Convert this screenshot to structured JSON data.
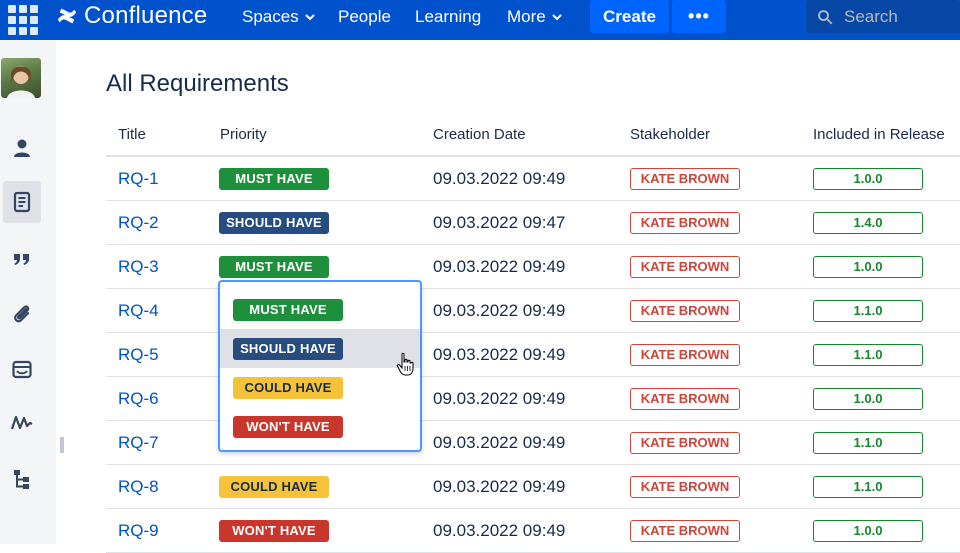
{
  "topnav": {
    "logo_text": "Confluence",
    "items": [
      {
        "label": "Spaces",
        "has_dropdown": true
      },
      {
        "label": "People",
        "has_dropdown": false
      },
      {
        "label": "Learning",
        "has_dropdown": false
      },
      {
        "label": "More",
        "has_dropdown": true
      }
    ],
    "create_label": "Create",
    "more_label": "•••",
    "search_placeholder": "Search",
    "colors": {
      "bar": "#0052CC",
      "button": "#0065FF",
      "search": "#0747A6"
    }
  },
  "sidebar": {
    "icons": [
      "avatar",
      "person-icon",
      "page-icon",
      "quote-icon",
      "attachment-icon",
      "calendar-icon",
      "analytics-icon",
      "tree-icon"
    ],
    "active": "page-icon"
  },
  "page": {
    "title": "All Requirements"
  },
  "table": {
    "headers": [
      "Title",
      "Priority",
      "Creation Date",
      "Stakeholder",
      "Included in Release"
    ],
    "rows": [
      {
        "title": "RQ-1",
        "priority": "MUST HAVE",
        "priority_type": "must",
        "date": "09.03.2022 09:49",
        "stakeholder": "KATE BROWN",
        "release": "1.0.0"
      },
      {
        "title": "RQ-2",
        "priority": "SHOULD HAVE",
        "priority_type": "should",
        "date": "09.03.2022 09:47",
        "stakeholder": "KATE BROWN",
        "release": "1.4.0"
      },
      {
        "title": "RQ-3",
        "priority": "MUST HAVE",
        "priority_type": "must",
        "date": "09.03.2022 09:49",
        "stakeholder": "KATE BROWN",
        "release": "1.0.0"
      },
      {
        "title": "RQ-4",
        "priority": "",
        "priority_type": "",
        "date": "09.03.2022 09:49",
        "stakeholder": "KATE BROWN",
        "release": "1.1.0"
      },
      {
        "title": "RQ-5",
        "priority": "",
        "priority_type": "",
        "date": "09.03.2022 09:49",
        "stakeholder": "KATE BROWN",
        "release": "1.1.0"
      },
      {
        "title": "RQ-6",
        "priority": "",
        "priority_type": "",
        "date": "09.03.2022 09:49",
        "stakeholder": "KATE BROWN",
        "release": "1.0.0"
      },
      {
        "title": "RQ-7",
        "priority": "",
        "priority_type": "",
        "date": "09.03.2022 09:49",
        "stakeholder": "KATE BROWN",
        "release": "1.1.0"
      },
      {
        "title": "RQ-8",
        "priority": "COULD HAVE",
        "priority_type": "could",
        "date": "09.03.2022 09:49",
        "stakeholder": "KATE BROWN",
        "release": "1.1.0"
      },
      {
        "title": "RQ-9",
        "priority": "WON'T HAVE",
        "priority_type": "wont",
        "date": "09.03.2022 09:49",
        "stakeholder": "KATE BROWN",
        "release": "1.0.0"
      }
    ]
  },
  "priority_dropdown": {
    "options": [
      {
        "label": "MUST HAVE",
        "type": "must"
      },
      {
        "label": "SHOULD HAVE",
        "type": "should"
      },
      {
        "label": "COULD HAVE",
        "type": "could"
      },
      {
        "label": "WON'T HAVE",
        "type": "wont"
      }
    ],
    "hovered": "SHOULD HAVE"
  },
  "colors": {
    "must": "#1E8F3A",
    "should": "#264C80",
    "could": "#F5C23A",
    "wont": "#C9372C",
    "stakeholder": "#D04437",
    "release": "#14892C",
    "link": "#0052CC"
  }
}
